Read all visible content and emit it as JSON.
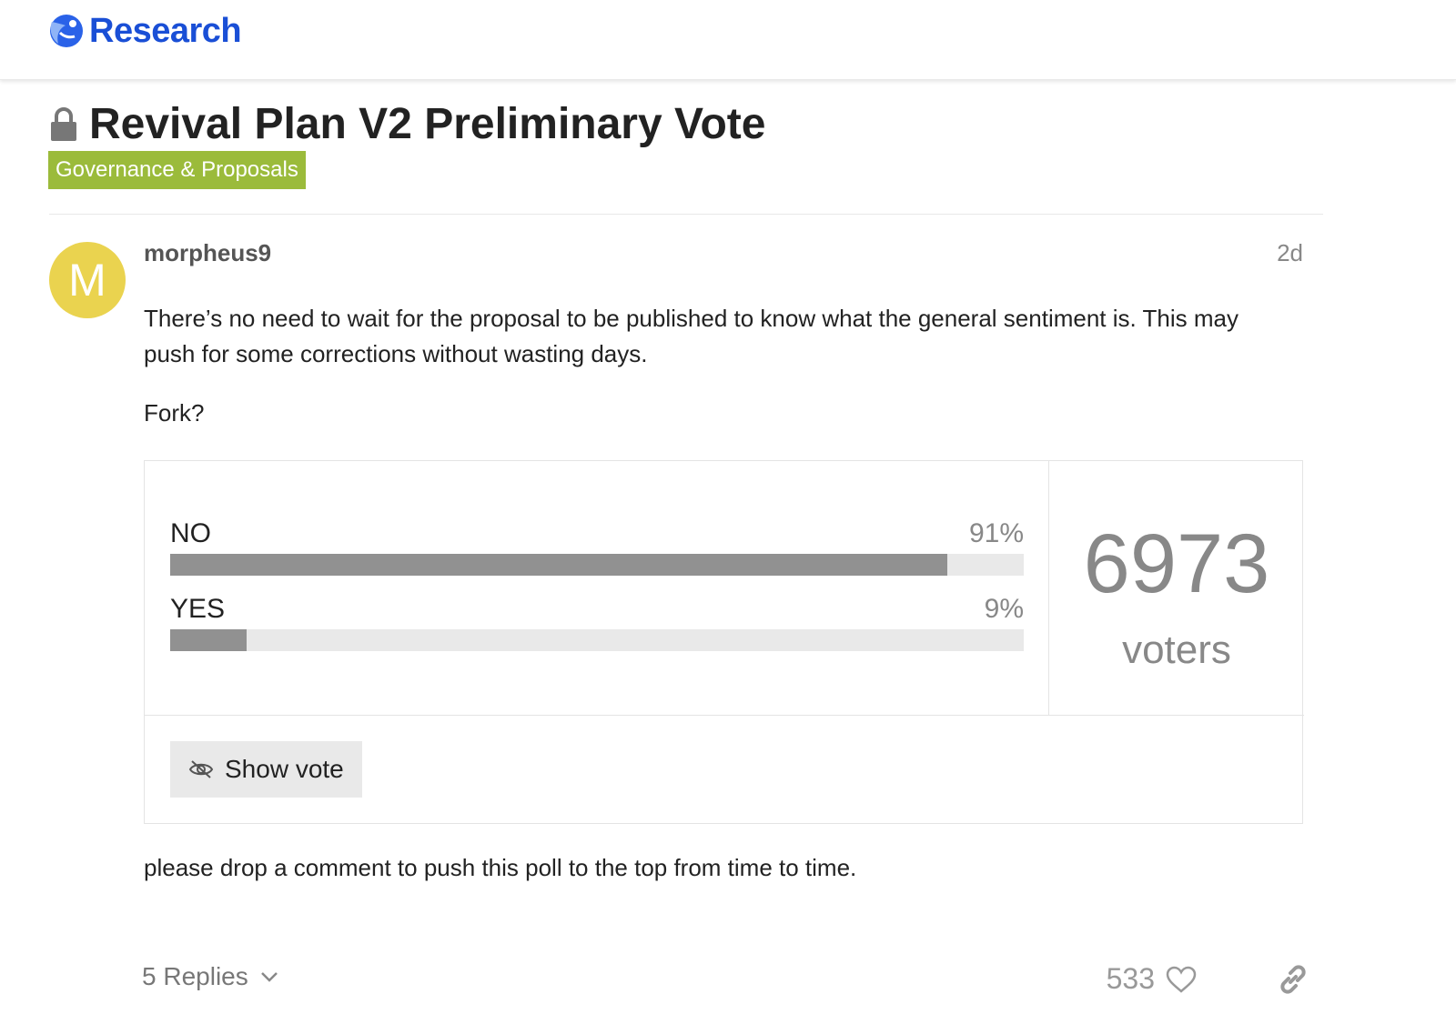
{
  "header": {
    "logo_text": "Research"
  },
  "topic": {
    "title": "Revival Plan V2 Preliminary Vote",
    "category": "Governance & Proposals",
    "category_color": "#9bbb3b"
  },
  "post": {
    "avatar_letter": "M",
    "avatar_color": "#ead34f",
    "username": "morpheus9",
    "date": "2d",
    "paragraph_1": "There’s no need to wait for the proposal to be published to know what the general sentiment is. This may push for some corrections without wasting days.",
    "paragraph_2": "Fork?",
    "closing_text": "please drop a comment to push this poll to the top from time to time."
  },
  "poll": {
    "options": [
      {
        "label": "NO",
        "percent_label": "91%",
        "percent": 91
      },
      {
        "label": "YES",
        "percent_label": "9%",
        "percent": 9
      }
    ],
    "voter_count": "6973",
    "voter_label": "voters",
    "show_vote_label": "Show vote"
  },
  "footer": {
    "replies_label": "5 Replies",
    "like_count": "533"
  },
  "icons": {
    "logo": "research-logo-icon",
    "lock": "lock-icon",
    "eye_slash": "eye-slash-icon",
    "chevron": "chevron-down-icon",
    "heart": "heart-icon",
    "link": "link-icon"
  }
}
